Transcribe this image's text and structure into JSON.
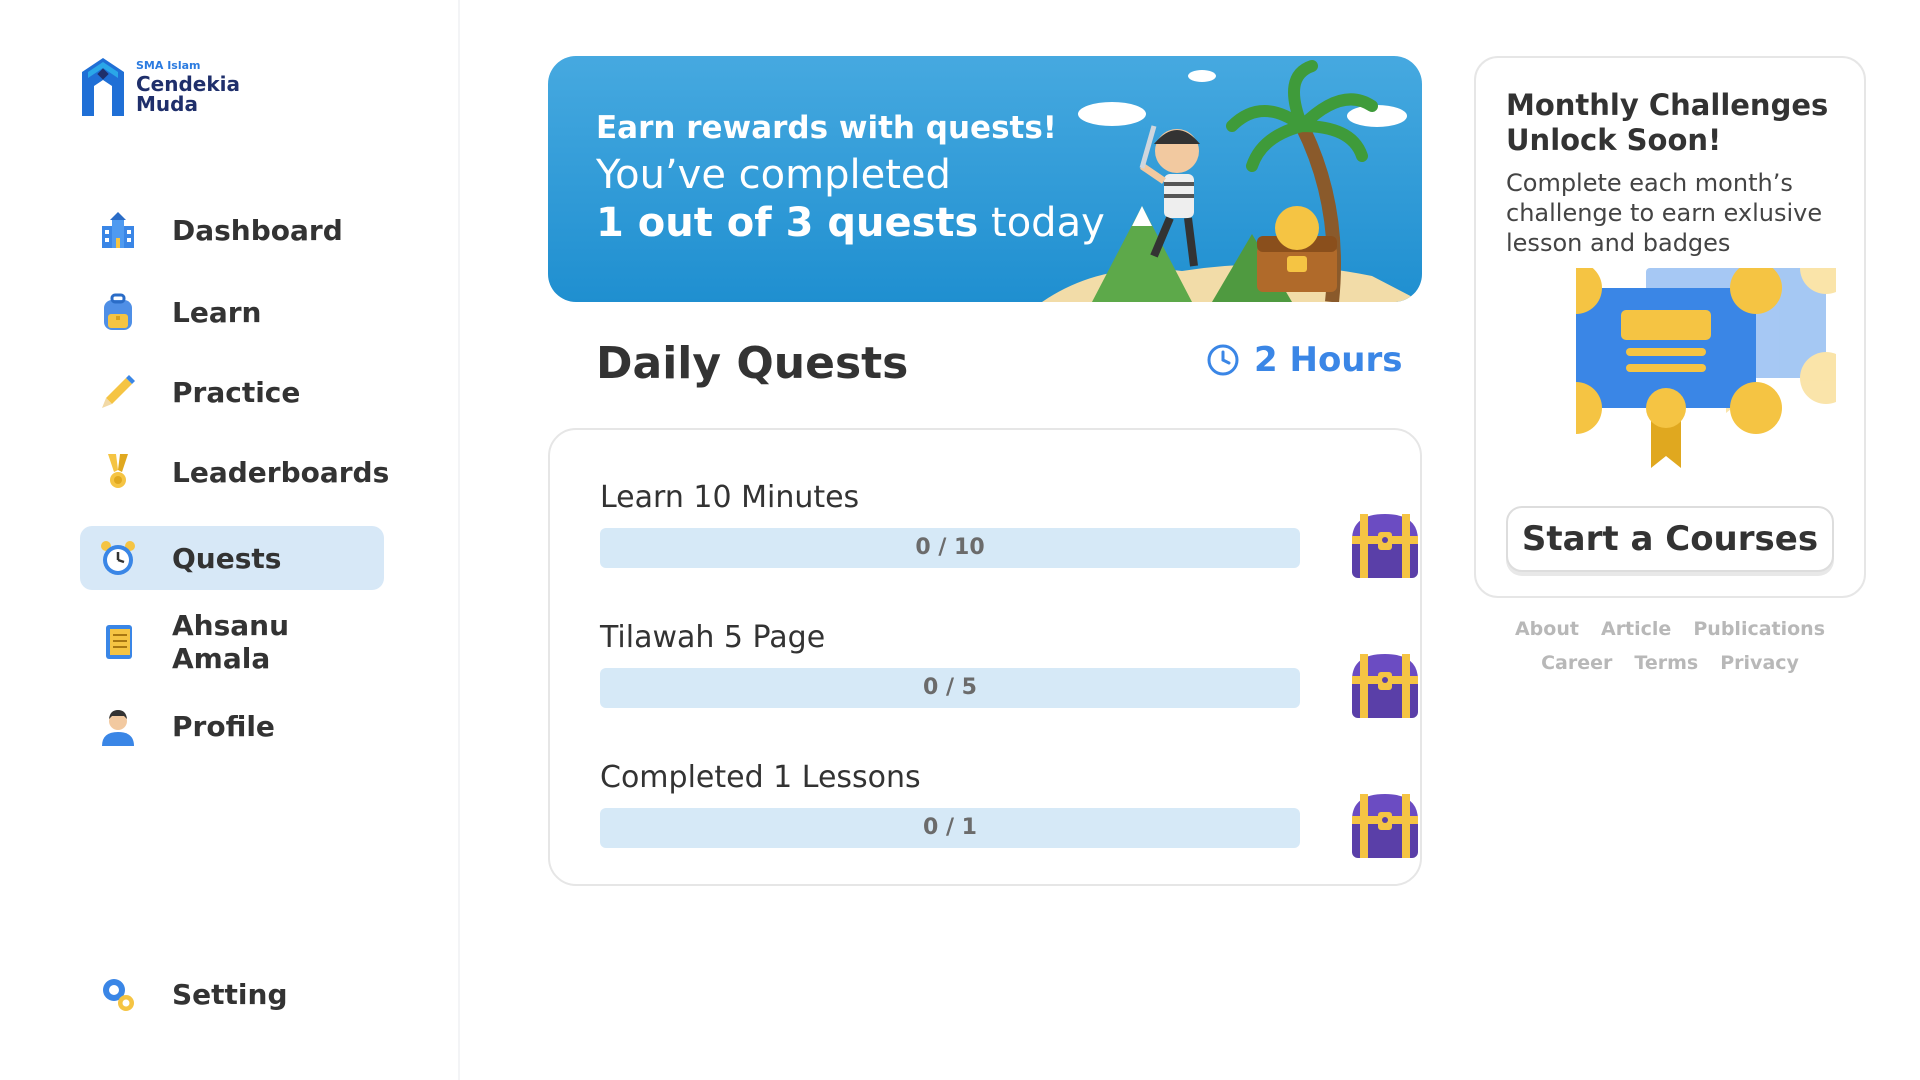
{
  "brand": {
    "small": "SMA Islam",
    "line1": "Cendekia",
    "line2": "Muda"
  },
  "sidebar": {
    "items": [
      {
        "label": "Dashboard",
        "icon": "school-building-icon"
      },
      {
        "label": "Learn",
        "icon": "backpack-icon"
      },
      {
        "label": "Practice",
        "icon": "pencil-icon"
      },
      {
        "label": "Leaderboards",
        "icon": "medal-icon"
      },
      {
        "label": "Quests",
        "icon": "alarm-clock-icon",
        "active": true
      },
      {
        "label": "Ahsanu Amala",
        "icon": "notebook-icon"
      },
      {
        "label": "Profile",
        "icon": "user-avatar-icon"
      }
    ],
    "setting": {
      "label": "Setting",
      "icon": "gears-icon"
    }
  },
  "banner": {
    "line1": "Earn rewards with quests!",
    "line2": "You’ve completed",
    "line3_bold": "1 out of 3 quests",
    "line3_rest": " today"
  },
  "daily": {
    "title": "Daily Quests",
    "timer": "2 Hours"
  },
  "quests": [
    {
      "title": "Learn 10 Minutes",
      "count": "0 / 10",
      "progress": 0
    },
    {
      "title": "Tilawah 5 Page",
      "count": "0 / 5",
      "progress": 0
    },
    {
      "title": "Completed 1 Lessons",
      "count": "0 / 1",
      "progress": 0
    }
  ],
  "monthly": {
    "title": "Monthly Challenges Unlock Soon!",
    "description": "Complete each month’s challenge to earn exlusive lesson and badges",
    "button": "Start a Courses"
  },
  "footer": {
    "row1": [
      "About",
      "Article",
      "Publications"
    ],
    "row2": [
      "Career",
      "Terms",
      "Privacy"
    ]
  },
  "colors": {
    "accent": "#3a86e6",
    "active_bg": "#d7e8f7",
    "banner": "#2b9ad8",
    "bar_bg": "#d6e9f7"
  }
}
